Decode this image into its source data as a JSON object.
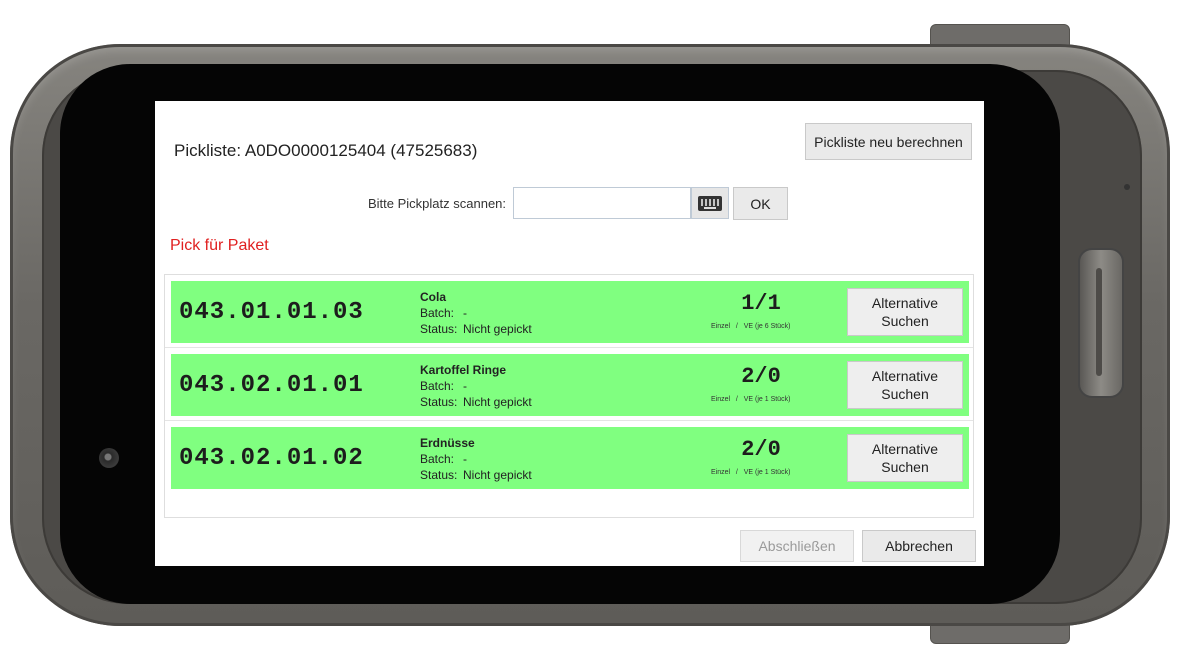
{
  "header": {
    "picklist_label": "Pickliste: A0DO0000125404 (47525683)",
    "recalc_button": "Pickliste neu berechnen"
  },
  "scan": {
    "label": "Bitte Pickplatz scannen:",
    "value": "",
    "keyboard_icon": "keyboard-icon",
    "ok_button": "OK"
  },
  "pick_heading": "Pick für Paket",
  "picks": [
    {
      "location": "043.01.01.03",
      "name": "Cola",
      "batch_label": "Batch:",
      "batch": "-",
      "status_label": "Status:",
      "status": "Nicht gepickt",
      "quantity": "1/1",
      "unit_single": "Einzel",
      "unit_sep": "/",
      "unit_pack": "VE (je 6 Stück)",
      "alt_button": "Alternative Suchen"
    },
    {
      "location": "043.02.01.01",
      "name": "Kartoffel Ringe",
      "batch_label": "Batch:",
      "batch": "-",
      "status_label": "Status:",
      "status": "Nicht gepickt",
      "quantity": "2/0",
      "unit_single": "Einzel",
      "unit_sep": "/",
      "unit_pack": "VE (je 1 Stück)",
      "alt_button": "Alternative Suchen"
    },
    {
      "location": "043.02.01.02",
      "name": "Erdnüsse",
      "batch_label": "Batch:",
      "batch": "-",
      "status_label": "Status:",
      "status": "Nicht gepickt",
      "quantity": "2/0",
      "unit_single": "Einzel",
      "unit_sep": "/",
      "unit_pack": "VE (je 1 Stück)",
      "alt_button": "Alternative Suchen"
    }
  ],
  "footer": {
    "finish_button": "Abschließen",
    "cancel_button": "Abbrechen"
  },
  "colors": {
    "row_green": "#80ff80",
    "heading_red": "#e02020"
  }
}
